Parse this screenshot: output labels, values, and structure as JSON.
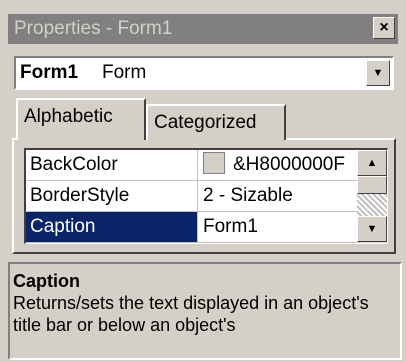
{
  "window": {
    "title": "Properties - Form1",
    "close_label": "×"
  },
  "object_selector": {
    "name": "Form1",
    "type": "Form"
  },
  "tabs": [
    {
      "label": "Alphabetic",
      "active": true
    },
    {
      "label": "Categorized",
      "active": false
    }
  ],
  "properties": [
    {
      "name": "BackColor",
      "value": "&H8000000F"
    },
    {
      "name": "BorderStyle",
      "value": "2 - Sizable"
    },
    {
      "name": "Caption",
      "value": "Form1"
    }
  ],
  "description": {
    "title": "Caption",
    "text": "Returns/sets the text displayed in an object's title bar or below an object's"
  },
  "colors": {
    "selection": "#0a246a",
    "inactive_title": "#808080",
    "face": "#d4d0c8"
  }
}
